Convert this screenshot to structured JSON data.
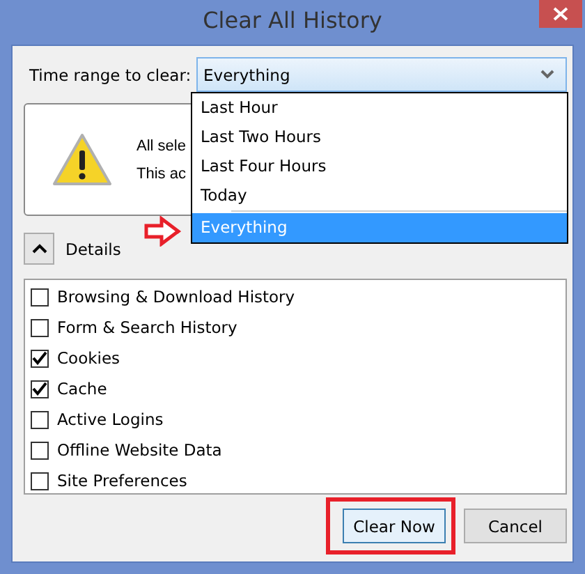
{
  "window": {
    "title": "Clear All History"
  },
  "time_range": {
    "label": "Time range to clear:",
    "value": "Everything",
    "expanded": true,
    "options": [
      {
        "label": "Last Hour",
        "selected": false,
        "separator_before": false
      },
      {
        "label": "Last Two Hours",
        "selected": false,
        "separator_before": false
      },
      {
        "label": "Last Four Hours",
        "selected": false,
        "separator_before": false
      },
      {
        "label": "Today",
        "selected": false,
        "separator_before": false
      },
      {
        "label": "Everything",
        "selected": true,
        "separator_before": true
      }
    ]
  },
  "warning": {
    "lines": [
      "All sele",
      "This ac"
    ]
  },
  "details": {
    "label": "Details",
    "expanded": true
  },
  "items": [
    {
      "label": "Browsing & Download History",
      "checked": false
    },
    {
      "label": "Form & Search History",
      "checked": false
    },
    {
      "label": "Cookies",
      "checked": true
    },
    {
      "label": "Cache",
      "checked": true
    },
    {
      "label": "Active Logins",
      "checked": false
    },
    {
      "label": "Offline Website Data",
      "checked": false
    },
    {
      "label": "Site Preferences",
      "checked": false
    }
  ],
  "buttons": [
    {
      "label": "Clear Now",
      "default": true
    },
    {
      "label": "Cancel",
      "default": false
    }
  ]
}
